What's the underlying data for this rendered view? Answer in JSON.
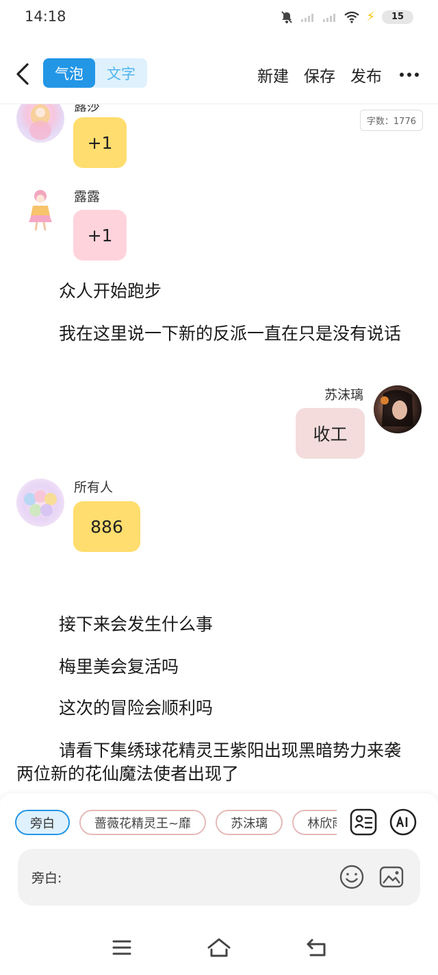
{
  "status_bar": {
    "time": "14:18",
    "battery_level": "15",
    "icons": [
      "mute-icon",
      "signal-icon",
      "signal-icon",
      "wifi-icon",
      "charging-icon",
      "battery-icon"
    ]
  },
  "header": {
    "modes": [
      "气泡",
      "文字"
    ],
    "active_mode": "气泡",
    "actions": {
      "new_label": "新建",
      "save_label": "保存",
      "publish_label": "发布"
    }
  },
  "content": {
    "word_count": "字数：1776",
    "messages": [
      {
        "speaker": "露莎",
        "text": "+1",
        "side": "left",
        "bubble_color": "#ffdd6e"
      },
      {
        "speaker": "露露",
        "text": "+1",
        "side": "left",
        "bubble_color": "#ffd3dc"
      },
      {
        "narration": "众人开始跑步"
      },
      {
        "narration": "我在这里说一下新的反派一直在只是没有说话"
      },
      {
        "speaker": "苏沫璃",
        "text": "收工",
        "side": "right",
        "bubble_color": "#f4dcdc"
      },
      {
        "speaker": "所有人",
        "text": "886",
        "side": "left",
        "bubble_color": "#ffdd6e"
      },
      {
        "narration": "接下来会发生什么事"
      },
      {
        "narration": "梅里美会复活吗"
      },
      {
        "narration": "这次的冒险会顺利吗"
      },
      {
        "narration": "请看下集绣球花精灵王紫阳出现黑暗势力来袭两位新的花仙魔法使者出现了"
      }
    ]
  },
  "input_panel": {
    "roles": [
      "旁白",
      "蔷薇花精灵王~靡",
      "苏沫璃",
      "林欣雨"
    ],
    "active_role": "旁白",
    "input_label": "旁白:",
    "input_value": ""
  },
  "colors": {
    "accent": "#2396e6",
    "accent_light": "#dff1fd",
    "yellow_bubble": "#ffdd6e",
    "pink_bubble": "#ffd3dc",
    "rose_bubble": "#f4dcdc"
  }
}
